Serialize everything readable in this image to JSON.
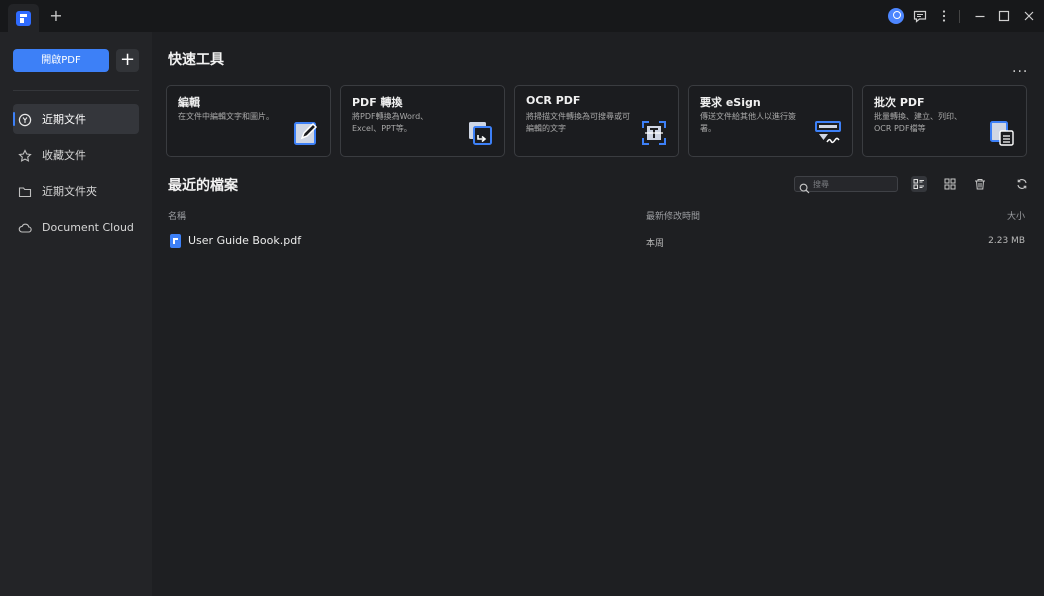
{
  "titlebar": {
    "tab_add_label": "+"
  },
  "sidebar": {
    "open_pdf_label": "開啟PDF",
    "add_label": "+",
    "items": [
      {
        "label": "近期文件",
        "icon": "recent-icon",
        "active": true
      },
      {
        "label": "收藏文件",
        "icon": "star-icon",
        "active": false
      },
      {
        "label": "近期文件夾",
        "icon": "folder-icon",
        "active": false
      },
      {
        "label": "Document Cloud",
        "icon": "cloud-icon",
        "active": false
      }
    ]
  },
  "quick_tools": {
    "title": "快速工具",
    "more_label": "...",
    "cards": [
      {
        "title": "編輯",
        "desc": "在文件中編輯文字和圖片。",
        "icon": "edit-icon"
      },
      {
        "title": "PDF 轉換",
        "desc": "將PDF轉換為Word、Excel、PPT等。",
        "icon": "convert-icon"
      },
      {
        "title": "OCR PDF",
        "desc": "將掃描文件轉換為可搜尋或可編輯的文字",
        "icon": "ocr-icon"
      },
      {
        "title": "要求 eSign",
        "desc": "傳送文件給其他人以進行簽署。",
        "icon": "esign-icon"
      },
      {
        "title": "批次 PDF",
        "desc": "批量轉換、建立、列印、OCR PDF檔等",
        "icon": "batch-icon"
      }
    ]
  },
  "recent_files": {
    "title": "最近的檔案",
    "search_placeholder": "搜尋",
    "columns": {
      "name": "名稱",
      "modified": "最新修改時間",
      "size": "大小"
    },
    "rows": [
      {
        "name": "User Guide Book.pdf",
        "modified": "本周",
        "size": "2.23 MB"
      }
    ]
  },
  "colors": {
    "accent": "#3d80f7",
    "background": "#1e1f22",
    "sidebar": "#232427",
    "titlebar": "#17181a"
  }
}
